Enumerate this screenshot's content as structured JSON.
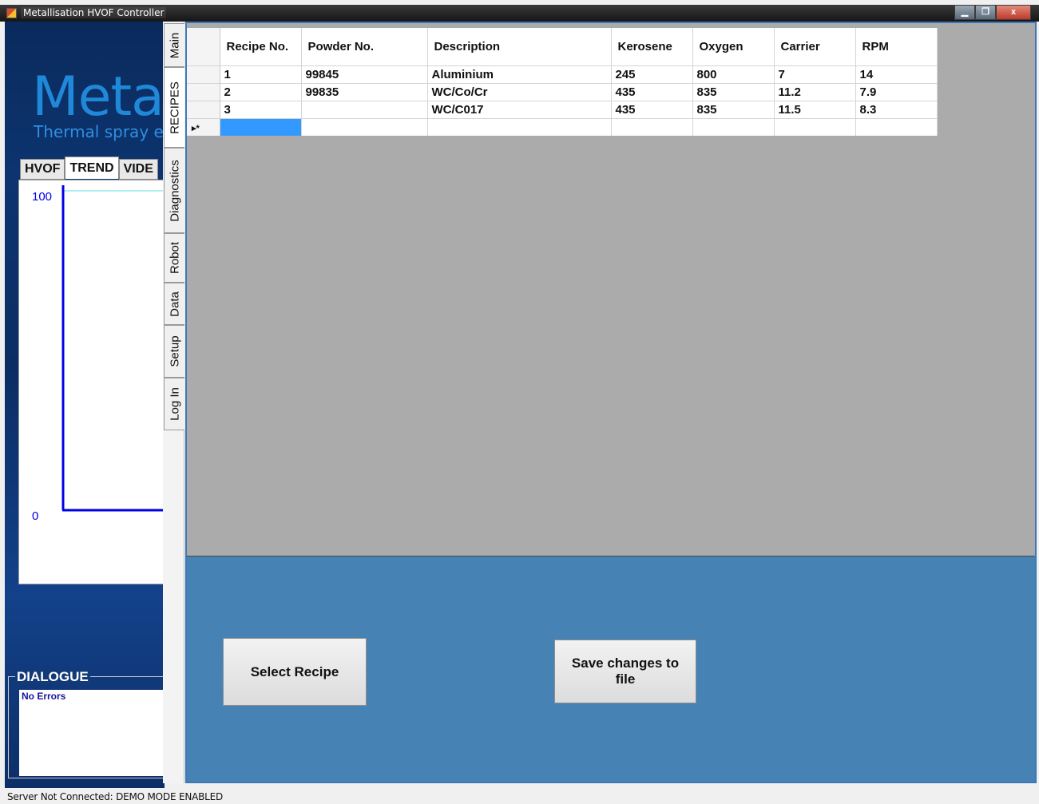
{
  "window": {
    "title": "Metallisation HVOF Controller",
    "icon": "app-icon",
    "controls": [
      "minimize-icon",
      "maximize-icon",
      "close-icon"
    ],
    "close_glyph": "x"
  },
  "left_panel": {
    "brand": "Metal",
    "tagline": "Thermal spray equ",
    "subtabs": [
      {
        "label": "HVOF",
        "active": false
      },
      {
        "label": "TREND",
        "active": true
      },
      {
        "label": "VIDE",
        "active": false
      }
    ],
    "trend": {
      "y_max_label": "100",
      "y_min_label": "0",
      "axis_color": "#0000e6",
      "line_color": "#66e0e0"
    },
    "dialogue": {
      "title": "DIALOGUE",
      "message": "No Errors"
    }
  },
  "vertical_tabs": [
    {
      "label": "Main",
      "active": false
    },
    {
      "label": "RECIPES",
      "active": true
    },
    {
      "label": "Diagnostics",
      "active": false
    },
    {
      "label": "Robot",
      "active": false
    },
    {
      "label": "Data",
      "active": false
    },
    {
      "label": "Setup",
      "active": false
    },
    {
      "label": "Log In",
      "active": false
    }
  ],
  "recipes": {
    "columns": [
      "Recipe No.",
      "Powder No.",
      "Description",
      "Kerosene",
      "Oxygen",
      "Carrier",
      "RPM"
    ],
    "rows": [
      [
        "1",
        "99845",
        "Aluminium",
        "245",
        "800",
        "7",
        "14"
      ],
      [
        "2",
        "99835",
        "WC/Co/Cr",
        "435",
        "835",
        "11.2",
        "7.9"
      ],
      [
        "3",
        "",
        "WC/C017",
        "435",
        "835",
        "11.5",
        "8.3"
      ]
    ],
    "new_row_marker": "▸*"
  },
  "buttons": {
    "select_recipe": "Select Recipe",
    "save_changes": "Save changes to file"
  },
  "status": {
    "text": "Server Not Connected: DEMO MODE ENABLED"
  },
  "colors": {
    "footer_bg": "#4682b4",
    "grid_bg": "#ababab",
    "selection": "#3399ff",
    "brand": "#1f88d8"
  }
}
